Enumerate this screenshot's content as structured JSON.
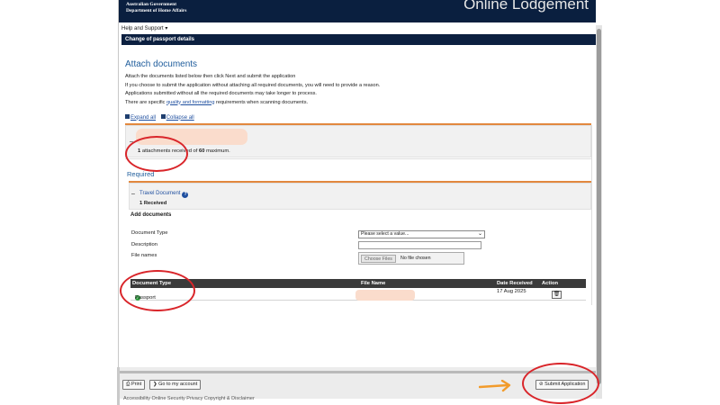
{
  "banner": {
    "gov_line1": "Australian Government",
    "gov_line2": "Department of Home Affairs",
    "title": "Online Lodgement"
  },
  "nav": {
    "help": "Help and Support ▾"
  },
  "page_title": "Change of passport details",
  "attach": {
    "heading": "Attach documents",
    "line1": "Attach the documents listed below then click Next and submit the application",
    "line2": "If you choose to submit the application without attaching all required documents, you will need to provide a reason.",
    "line3": "Applications submitted without all the required documents may take longer to process.",
    "line4_pre": "There are specific ",
    "line4_link": "quality and formatting",
    "line4_post": " requirements when scanning documents."
  },
  "controls": {
    "expand_all": "Expand all",
    "collapse_all": "Collapse all"
  },
  "summary": {
    "count": "1",
    "text_mid": " attachments received of ",
    "max": "60",
    "text_end": " maximum."
  },
  "required_label": "Required",
  "travel_document": {
    "name": "Travel Document",
    "received": "1 Received"
  },
  "add_documents": {
    "heading": "Add documents",
    "document_type_label": "Document Type",
    "description_label": "Description",
    "file_names_label": "File names",
    "select_placeholder": "Please select a value...",
    "choose_files": "Choose Files",
    "no_file": "No file chosen"
  },
  "table": {
    "headers": [
      "Document Type",
      "File Name",
      "Date Received",
      "Action"
    ],
    "rows": [
      {
        "type": "Passport",
        "date": "17 Aug 2025"
      }
    ]
  },
  "footer": {
    "print": "Print",
    "go_to_account": "Go to my account",
    "submit": "Submit Application",
    "links": "Accessibility  Online Security  Privacy  Copyright & Disclaimer"
  },
  "colors": {
    "navy": "#0a1f3f",
    "link_blue": "#1f5d9c",
    "accent_orange": "#e2883e",
    "annotation_red": "#d9252a"
  }
}
